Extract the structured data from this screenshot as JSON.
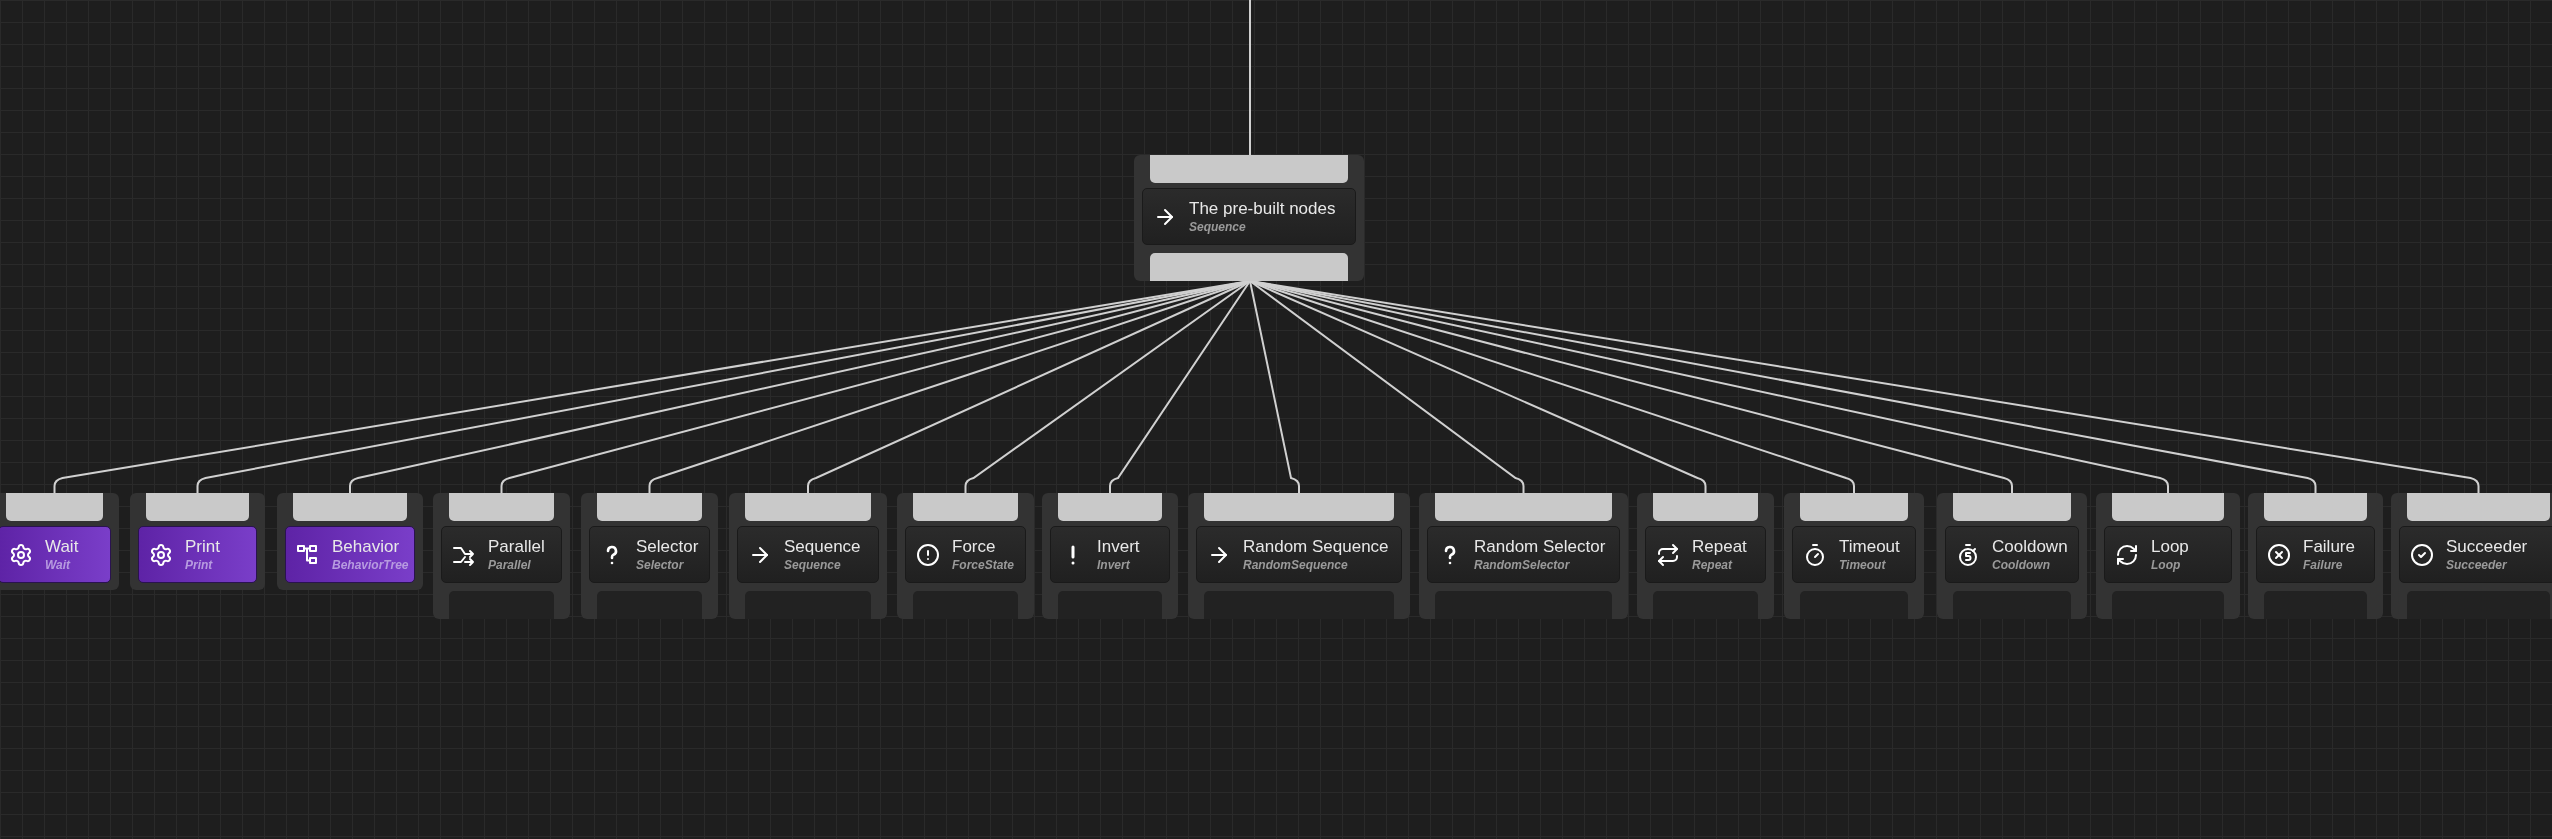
{
  "root": {
    "title": "The pre-built nodes",
    "type": "Sequence",
    "kind": "composite"
  },
  "nodes": [
    {
      "title": "Wait",
      "type": "Wait",
      "kind": "action"
    },
    {
      "title": "Print",
      "type": "Print",
      "kind": "action"
    },
    {
      "title": "Behavior",
      "type": "BehaviorTree",
      "kind": "action"
    },
    {
      "title": "Parallel",
      "type": "Parallel",
      "kind": "composite"
    },
    {
      "title": "Selector",
      "type": "Selector",
      "kind": "composite"
    },
    {
      "title": "Sequence",
      "type": "Sequence",
      "kind": "composite"
    },
    {
      "title": "Force",
      "type": "ForceState",
      "kind": "composite"
    },
    {
      "title": "Invert",
      "type": "Invert",
      "kind": "composite"
    },
    {
      "title": "Random Sequence",
      "type": "RandomSequence",
      "kind": "composite"
    },
    {
      "title": "Random Selector",
      "type": "RandomSelector",
      "kind": "composite"
    },
    {
      "title": "Repeat",
      "type": "Repeat",
      "kind": "composite"
    },
    {
      "title": "Timeout",
      "type": "Timeout",
      "kind": "composite"
    },
    {
      "title": "Cooldown",
      "type": "Cooldown",
      "kind": "composite"
    },
    {
      "title": "Loop",
      "type": "Loop",
      "kind": "composite"
    },
    {
      "title": "Failure",
      "type": "Failure",
      "kind": "composite"
    },
    {
      "title": "Succeeder",
      "type": "Succeeder",
      "kind": "composite"
    }
  ]
}
